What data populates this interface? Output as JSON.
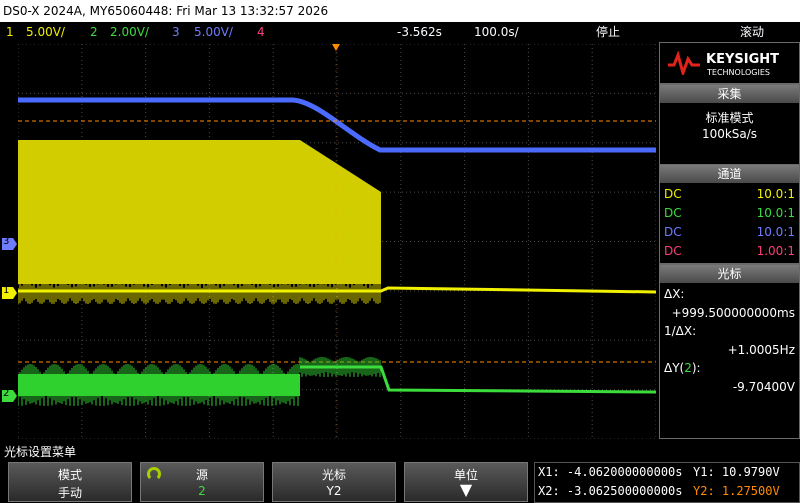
{
  "title_bar": {
    "text": "DS0-X 2024A, MY65060448: Fri Mar 13 13:32:57 2026"
  },
  "status_bar": {
    "ch1": {
      "num": "1",
      "scale": "5.00V/",
      "color": "#f0f000"
    },
    "ch2": {
      "num": "2",
      "scale": "2.00V/",
      "color": "#3cdc3c"
    },
    "ch3": {
      "num": "3",
      "scale": "5.00V/",
      "color": "#6f7cff"
    },
    "ch4": {
      "num": "4",
      "color": "#ff3c78"
    },
    "time_offset": "-3.562s",
    "time_scale": "100.0s/",
    "run_state": "停止",
    "mode": "滚动"
  },
  "markers": {
    "ch3": "3",
    "ch1": "1",
    "ch2": "2"
  },
  "right_panel": {
    "brand": "KEYSIGHT",
    "brand_sub": "TECHNOLOGIES",
    "acquire": {
      "header": "采集",
      "mode": "标准模式",
      "rate": "100kSa/s"
    },
    "channels": {
      "header": "通道",
      "rows": [
        {
          "coupling": "DC",
          "probe": "10.0:1",
          "color": "#f0f000"
        },
        {
          "coupling": "DC",
          "probe": "10.0:1",
          "color": "#3cdc3c"
        },
        {
          "coupling": "DC",
          "probe": "10.0:1",
          "color": "#6f7cff"
        },
        {
          "coupling": "DC",
          "probe": "1.00:1",
          "color": "#ff3c78"
        }
      ]
    },
    "cursors": {
      "header": "光标",
      "dx_label": "ΔX:",
      "dx_value": "+999.500000000ms",
      "inv_dx_label": "1/ΔX:",
      "inv_dx_value": "+1.0005Hz",
      "dy_label_prefix": "ΔY(",
      "dy_label_channel": "2",
      "dy_label_suffix": "):",
      "dy_value": "-9.70400V"
    }
  },
  "menu": {
    "title": "光标设置菜单",
    "softkeys": [
      {
        "label": "模式",
        "value": "手动"
      },
      {
        "label": "源",
        "value": "2"
      },
      {
        "label": "光标",
        "value": "Y2"
      },
      {
        "label": "单位",
        "value": "▼"
      }
    ]
  },
  "cursor_readout": {
    "x1": "X1: -4.062000000000s",
    "x2": "X2: -3.062500000000s",
    "y1": "Y1: 10.9790V",
    "y2": "Y2: 1.27500V",
    "y2_color": "#ff8c00"
  },
  "colors": {
    "cursor": "#ff8c00",
    "grid": "#4a4a4a"
  }
}
